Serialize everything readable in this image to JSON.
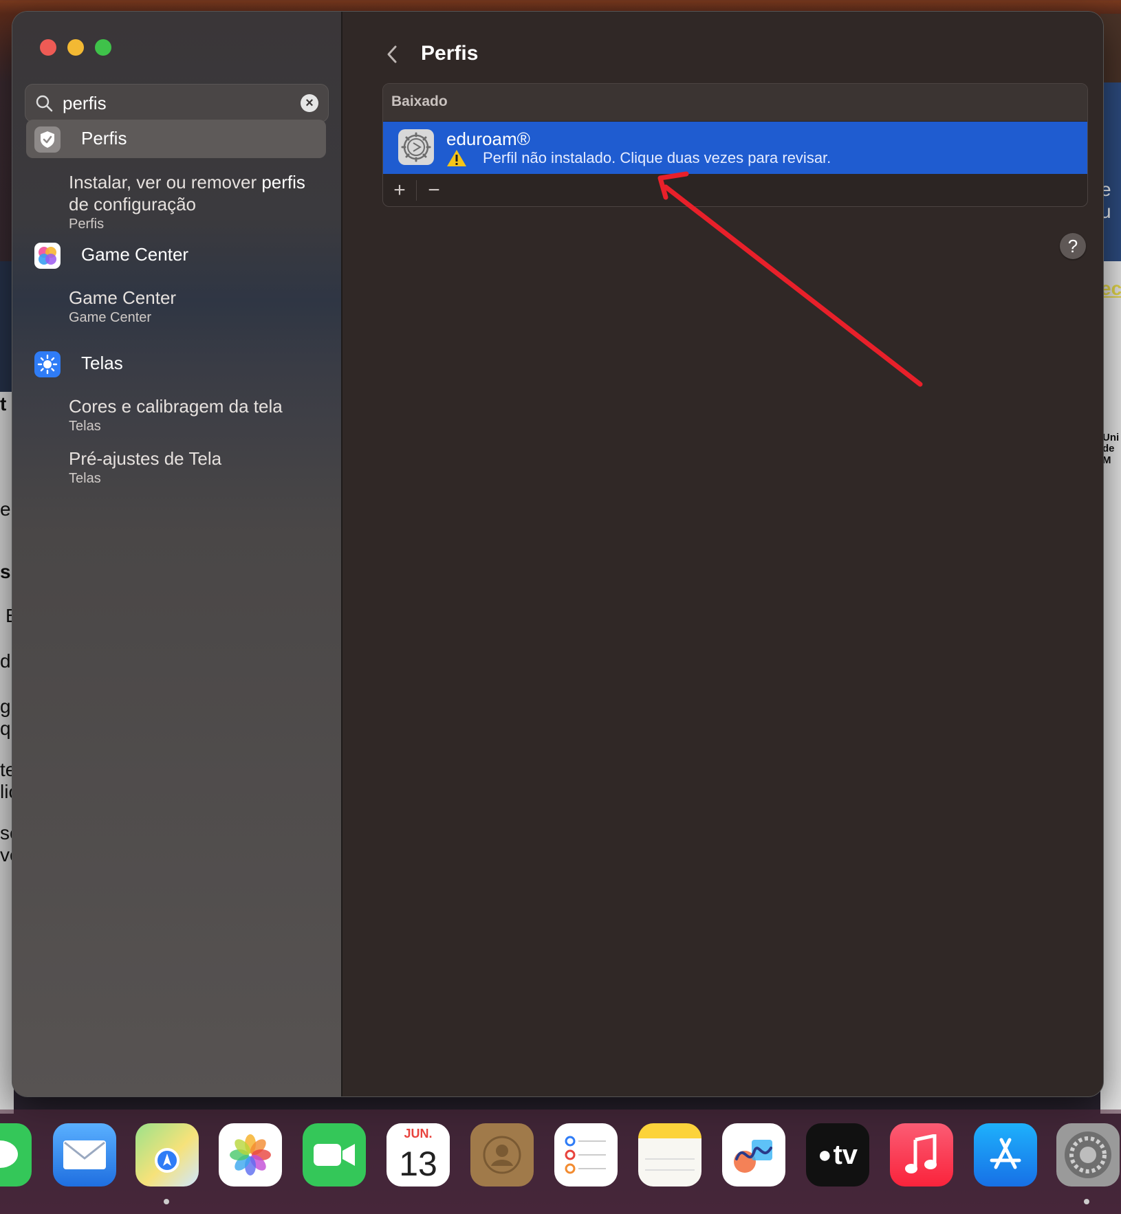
{
  "window": {
    "sidebar": {
      "search": {
        "value": "perfis"
      },
      "results": [
        {
          "title": "Perfis",
          "items": [
            {
              "title_prefix": "Instalar, ver ou remover ",
              "title_highlight": "perfis",
              "title_suffix": "de configuração",
              "caption": "Perfis"
            }
          ]
        },
        {
          "title": "Game Center",
          "items": [
            {
              "title": "Game Center",
              "caption": "Game Center"
            }
          ]
        },
        {
          "title": "Telas",
          "items": [
            {
              "title": "Cores e calibragem da tela",
              "caption": "Telas"
            },
            {
              "title": "Pré-ajustes de Tela",
              "caption": "Telas"
            }
          ]
        }
      ]
    },
    "main": {
      "title": "Perfis",
      "section_header": "Baixado",
      "profile": {
        "name": "eduroam®",
        "status": "Perfil não instalado. Clique duas vezes para revisar."
      },
      "add_label": "+",
      "remove_label": "−",
      "help_label": "?"
    }
  },
  "background": {
    "fragments_left": [
      "t",
      "e",
      "s",
      "E",
      "d",
      "g",
      "qu",
      "te",
      "lic",
      "se",
      "ve"
    ],
    "fragments_right": [
      "e u",
      "eci",
      "Uni",
      "de M"
    ]
  },
  "dock": {
    "calendar": {
      "month": "JUN.",
      "day": "13"
    },
    "tv_label": "tv",
    "apps": [
      "Messages",
      "Mail",
      "Maps",
      "Photos",
      "FaceTime",
      "Calendar",
      "Contacts",
      "Reminders",
      "Notes",
      "Freeform",
      "TV",
      "Music",
      "App Store",
      "System Settings"
    ]
  },
  "colors": {
    "accent": "#1f5cd0",
    "arrow": "#e8202a",
    "warning": "#f5c518"
  }
}
